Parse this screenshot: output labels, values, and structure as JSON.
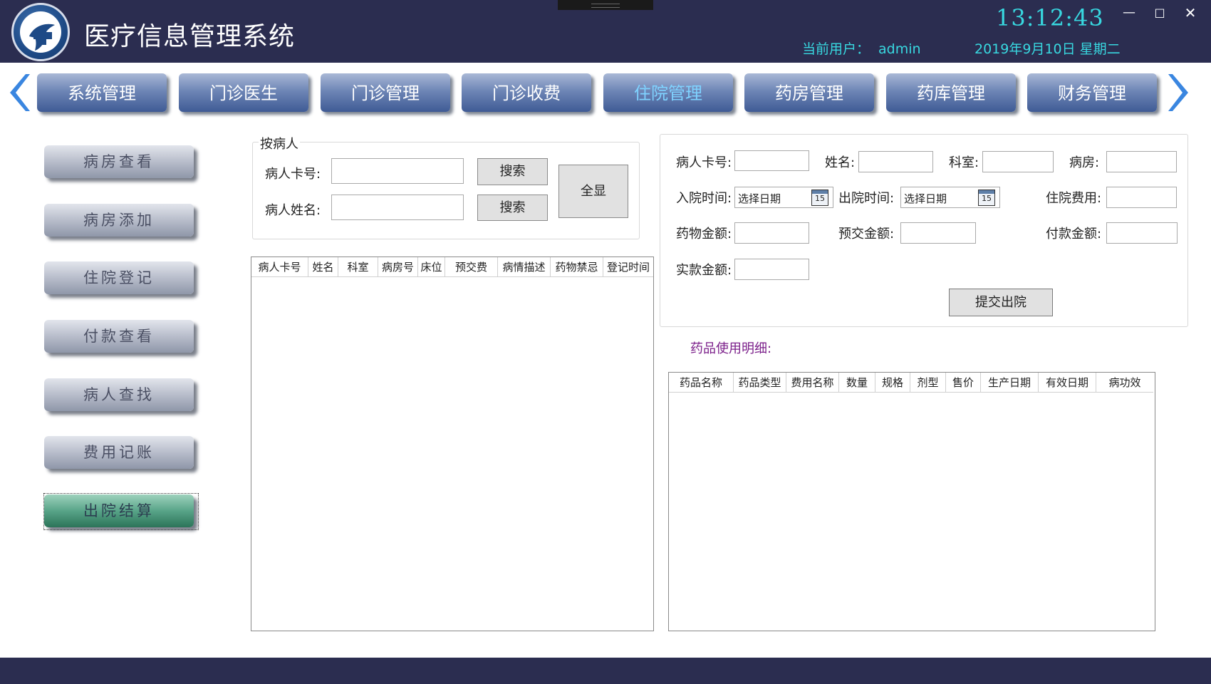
{
  "app": {
    "title": "医疗信息管理系统",
    "clock": "13:12:43",
    "user_label": "当前用户：",
    "user_name": "admin",
    "date": "2019年9月10日 星期二"
  },
  "nav": {
    "tabs": [
      {
        "label": "系统管理"
      },
      {
        "label": "门诊医生"
      },
      {
        "label": "门诊管理"
      },
      {
        "label": "门诊收费"
      },
      {
        "label": "住院管理",
        "active": true
      },
      {
        "label": "药房管理"
      },
      {
        "label": "药库管理"
      },
      {
        "label": "财务管理"
      }
    ]
  },
  "sidebar": {
    "items": [
      {
        "label": "病房查看"
      },
      {
        "label": "病房添加"
      },
      {
        "label": "住院登记"
      },
      {
        "label": "付款查看"
      },
      {
        "label": "病人查找"
      },
      {
        "label": "费用记账"
      },
      {
        "label": "出院结算",
        "active": true
      }
    ]
  },
  "search": {
    "legend": "按病人",
    "card_label": "病人卡号:",
    "name_label": "病人姓名:",
    "card_value": "",
    "name_value": "",
    "search_btn_1": "搜索",
    "search_btn_2": "搜索",
    "show_all_btn": "全显"
  },
  "patient_grid": {
    "columns": [
      "病人卡号",
      "姓名",
      "科室",
      "病房号",
      "床位",
      "预交费",
      "病情描述",
      "药物禁忌",
      "登记时间"
    ],
    "rows": []
  },
  "detail": {
    "card_label": "病人卡号:",
    "name_label": "姓名:",
    "dept_label": "科室:",
    "ward_label": "病房:",
    "admit_label": "入院时间:",
    "admit_placeholder": "选择日期",
    "discharge_label": "出院时间:",
    "discharge_placeholder": "选择日期",
    "calendar_day": "15",
    "cost_label": "住院费用:",
    "drug_amount_label": "药物金额:",
    "prepay_label": "预交金额:",
    "paid_label": "付款金额:",
    "actual_label": "实款金额:",
    "submit_btn": "提交出院"
  },
  "drug_detail": {
    "title": "药品使用明细:",
    "columns": [
      "药品名称",
      "药品类型",
      "费用名称",
      "数量",
      "规格",
      "剂型",
      "售价",
      "生产日期",
      "有效日期",
      "病功效"
    ],
    "rows": []
  },
  "colors": {
    "header_bg": "#2b2d50",
    "accent_cyan": "#38d8e0",
    "active_tab_text": "#7fd2ff",
    "active_side_btn": "#58a488",
    "drug_title": "#7b1f8a"
  },
  "icons": {
    "logo": "medical-cross-logo",
    "nav_prev": "chevron-left-icon",
    "nav_next": "chevron-right-icon",
    "calendar": "calendar-icon"
  }
}
